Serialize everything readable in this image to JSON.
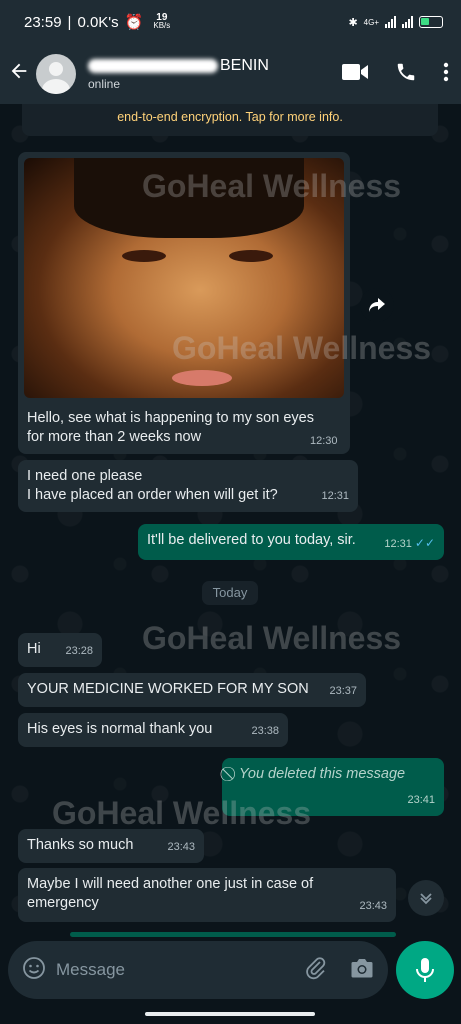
{
  "status_bar": {
    "time": "23:59",
    "speed": "0.0K's",
    "kbs_top": "19",
    "kbs_bottom": "KB/s",
    "network": "4G+"
  },
  "header": {
    "contact_suffix": "BENIN",
    "presence": "online"
  },
  "encryption_notice": "end-to-end encryption. Tap for more info.",
  "watermark": "GoHeal Wellness",
  "messages": [
    {
      "dir": "in",
      "text": "Hello, see what is happening to my son eyes for more than 2 weeks now",
      "time": "12:30"
    },
    {
      "dir": "in",
      "text_line1": "I need one please",
      "text_line2": "I have placed an order when will get it?",
      "time": "12:31"
    },
    {
      "dir": "out",
      "text": "It'll be delivered to you today, sir.",
      "time": "12:31"
    },
    {
      "dir": "in",
      "text": "Hi",
      "time": "23:28"
    },
    {
      "dir": "in",
      "text": "YOUR MEDICINE WORKED FOR MY SON",
      "time": "23:37"
    },
    {
      "dir": "in",
      "text": "His eyes is normal thank you",
      "time": "23:38"
    },
    {
      "dir": "out",
      "text": "You deleted this message",
      "time": "23:41"
    },
    {
      "dir": "in",
      "text": "Thanks so much",
      "time": "23:43"
    },
    {
      "dir": "in",
      "text": "Maybe I will need another one just in case of emergency",
      "time": "23:43"
    }
  ],
  "date_chip": "Today",
  "composer": {
    "placeholder": "Message"
  },
  "colors": {
    "incoming": "#202c33",
    "outgoing": "#005c4b",
    "accent": "#00a884",
    "read_ticks": "#53bdeb"
  }
}
